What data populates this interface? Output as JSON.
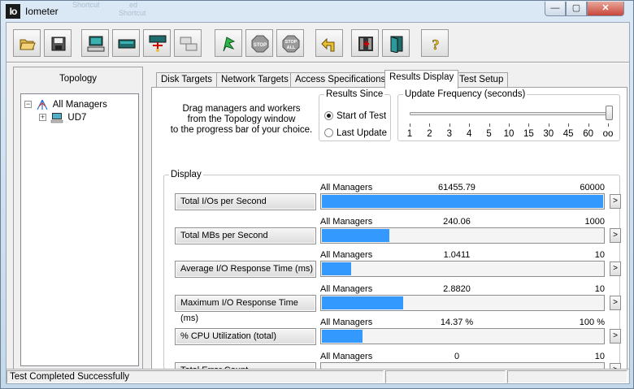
{
  "window": {
    "title": "Iometer",
    "icon_text": "Io",
    "ghost_labels": [
      "Shortcut",
      "ed",
      "Shortcut"
    ]
  },
  "title_buttons": {
    "minimize": "—",
    "maximize": "▢",
    "close": "✕"
  },
  "toolbar": {
    "buttons": [
      {
        "name": "open-config-button",
        "icon": "open-folder-icon"
      },
      {
        "name": "save-config-button",
        "icon": "save-disk-icon"
      },
      {
        "name": "new-disk-worker-button",
        "icon": "disk-worker-icon"
      },
      {
        "name": "new-network-worker-button",
        "icon": "network-worker-icon"
      },
      {
        "name": "duplicate-worker-button",
        "icon": "duplicate-worker-icon"
      },
      {
        "name": "disconnect-button",
        "icon": "disconnect-icon"
      },
      {
        "name": "start-tests-button",
        "icon": "green-flag-icon"
      },
      {
        "name": "stop-test-button",
        "icon": "stop-sign-icon",
        "label": "STOP"
      },
      {
        "name": "stop-all-button",
        "icon": "stop-all-icon",
        "label": "STOP",
        "sublabel": "ALL"
      },
      {
        "name": "reset-workers-button",
        "icon": "reset-arrow-icon"
      },
      {
        "name": "start-managers-button",
        "icon": "start-managers-icon"
      },
      {
        "name": "exit-button",
        "icon": "exit-door-icon"
      },
      {
        "name": "about-button",
        "icon": "help-question-icon",
        "label": "?"
      }
    ]
  },
  "topology": {
    "label": "Topology",
    "tree": [
      {
        "label": "All Managers",
        "expander": "−",
        "icon": "all-managers-icon"
      },
      {
        "label": "UD7",
        "expander": "+",
        "icon": "computer-icon"
      }
    ]
  },
  "tabs": [
    "Disk Targets",
    "Network Targets",
    "Access Specifications",
    "Results Display",
    "Test Setup"
  ],
  "active_tab": "Results Display",
  "results_display": {
    "hint_lines": [
      "Drag managers and workers",
      "from the Topology window",
      "to the progress bar of your choice."
    ],
    "results_since": {
      "legend": "Results Since",
      "options": [
        {
          "label": "Start of Test",
          "selected": true
        },
        {
          "label": "Last Update",
          "selected": false
        }
      ]
    },
    "update_frequency": {
      "legend": "Update Frequency (seconds)",
      "ticks": [
        "1",
        "2",
        "3",
        "4",
        "5",
        "10",
        "15",
        "30",
        "45",
        "60",
        "oo"
      ],
      "selected": "oo"
    },
    "display": {
      "legend": "Display",
      "more_label": ">",
      "metrics": [
        {
          "name": "Total I/Os per Second",
          "manager": "All Managers",
          "value": "61455.79",
          "max": "60000",
          "fill_fraction": 1.0
        },
        {
          "name": "Total MBs per Second",
          "manager": "All Managers",
          "value": "240.06",
          "max": "1000",
          "fill_fraction": 0.24
        },
        {
          "name": "Average I/O Response Time (ms)",
          "manager": "All Managers",
          "value": "1.0411",
          "max": "10",
          "fill_fraction": 0.104
        },
        {
          "name": "Maximum I/O Response Time (ms)",
          "manager": "All Managers",
          "value": "2.8820",
          "max": "10",
          "fill_fraction": 0.288
        },
        {
          "name": "% CPU Utilization (total)",
          "manager": "All Managers",
          "value": "14.37 %",
          "max": "100 %",
          "fill_fraction": 0.1437
        },
        {
          "name": "Total Error Count",
          "manager": "All Managers",
          "value": "0",
          "max": "10",
          "fill_fraction": 0
        }
      ]
    }
  },
  "status_bar": {
    "message": "Test Completed Successfully"
  }
}
